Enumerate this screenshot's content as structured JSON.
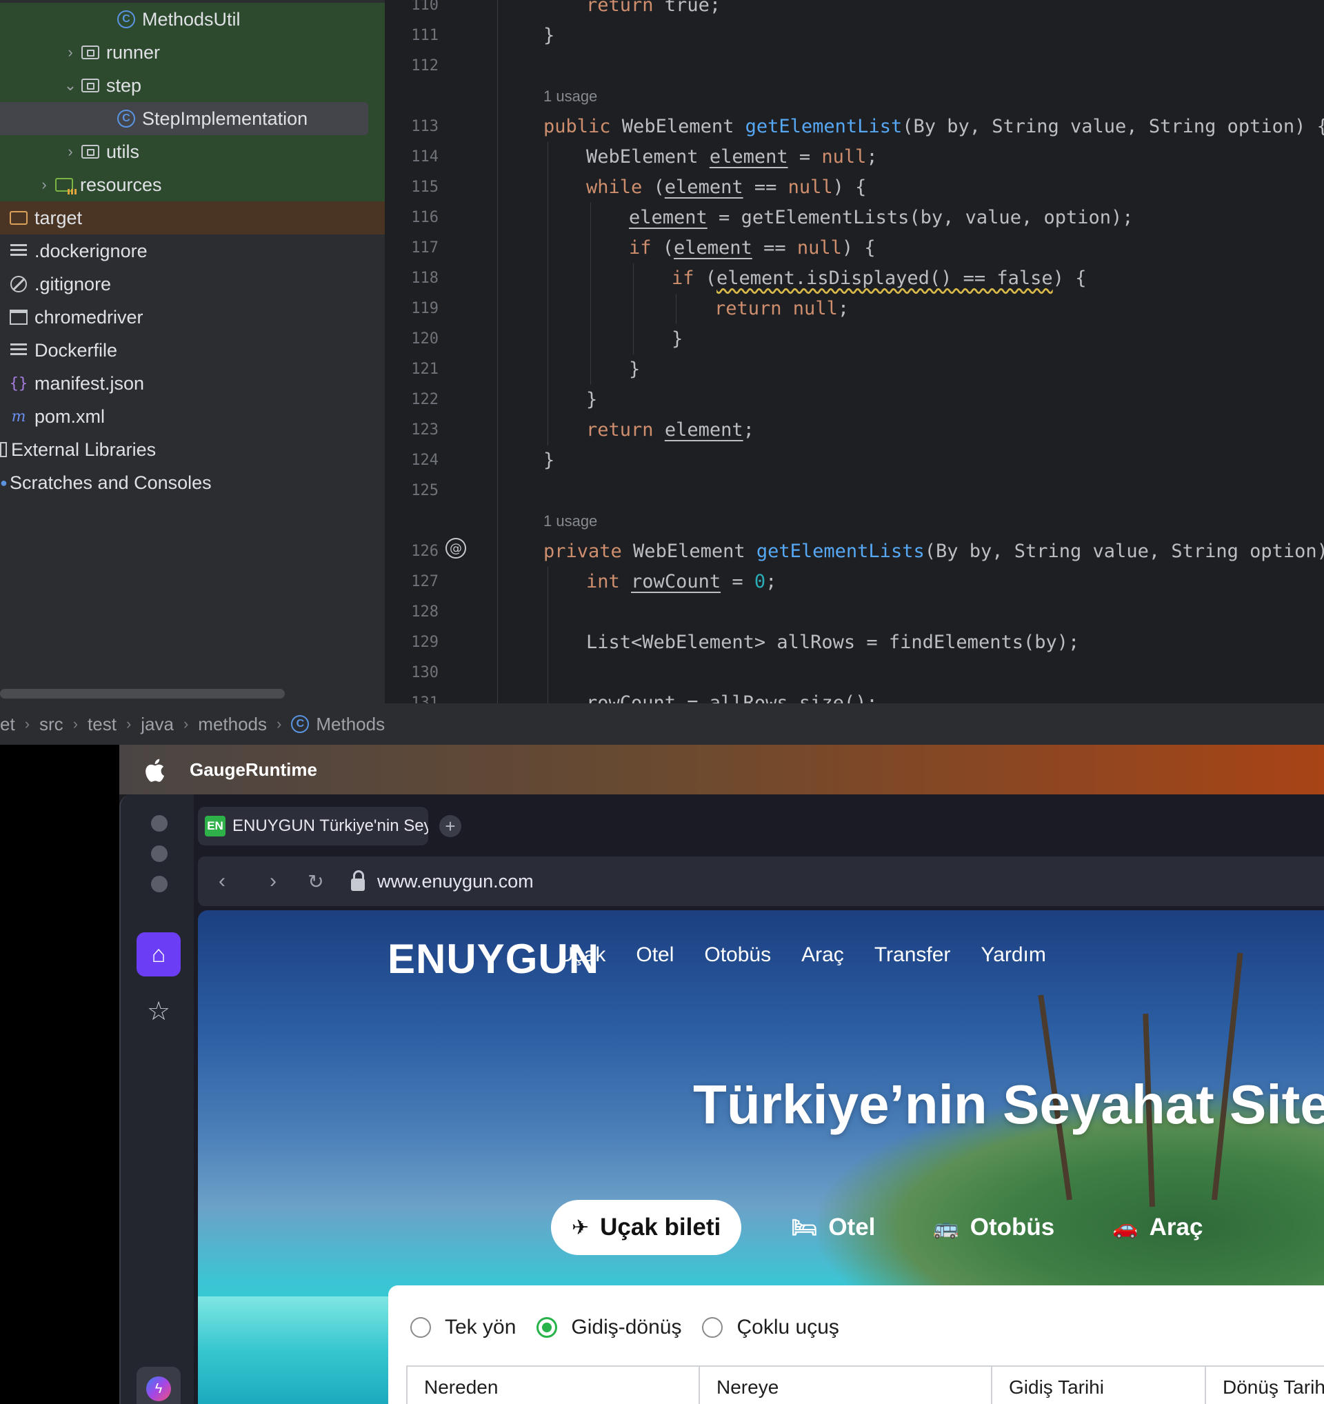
{
  "ide": {
    "tree": [
      {
        "label": "MethodsUtil",
        "icon": "class-icon",
        "indent": 3
      },
      {
        "label": "runner",
        "icon": "folder-icon",
        "indent": 2,
        "arrow": "›"
      },
      {
        "label": "step",
        "icon": "folder-icon",
        "indent": 2,
        "arrow": "⌄"
      },
      {
        "label": "StepImplementation",
        "icon": "class-icon",
        "indent": 3
      },
      {
        "label": "utils",
        "icon": "folder-icon",
        "indent": 2,
        "arrow": "›"
      },
      {
        "label": "resources",
        "icon": "resources-folder-icon",
        "indent": 1,
        "arrow": "›"
      },
      {
        "label": "target",
        "icon": "excluded-folder-icon",
        "indent": 0
      },
      {
        "label": ".dockerignore",
        "icon": "text-file-icon",
        "indent": 0
      },
      {
        "label": ".gitignore",
        "icon": "ignore-file-icon",
        "indent": 0
      },
      {
        "label": "chromedriver",
        "icon": "executable-icon",
        "indent": 0
      },
      {
        "label": "Dockerfile",
        "icon": "text-file-icon",
        "indent": 0
      },
      {
        "label": "manifest.json",
        "icon": "json-icon",
        "indent": 0
      },
      {
        "label": "pom.xml",
        "icon": "maven-icon",
        "indent": 0
      },
      {
        "label": "External Libraries",
        "icon": "library-icon",
        "indent": -1
      },
      {
        "label": "Scratches and Consoles",
        "icon": "scratches-icon",
        "indent": -1
      }
    ],
    "line_numbers": [
      "110",
      "111",
      "112",
      "113",
      "114",
      "115",
      "116",
      "117",
      "118",
      "119",
      "120",
      "121",
      "122",
      "123",
      "124",
      "125",
      "126",
      "127",
      "128",
      "129",
      "130",
      "131"
    ],
    "usage_label": "1 usage",
    "code": {
      "l110": [
        "return",
        " true;"
      ],
      "l111": "}",
      "l113": [
        "public",
        " WebElement ",
        "getElementList",
        "(By by, String value, String option) {"
      ],
      "l114": [
        "WebElement ",
        "element",
        " = ",
        "null",
        ";"
      ],
      "l115": [
        "while",
        " (",
        "element",
        " == ",
        "null",
        ") {"
      ],
      "l116": [
        "element",
        " = getElementLists(by, value, option);"
      ],
      "l117": [
        "if",
        " (",
        "element",
        " == ",
        "null",
        ") {"
      ],
      "l118": [
        "if",
        " (",
        "element.isDisplayed() == false",
        ") {"
      ],
      "l119": [
        "return",
        " null",
        ";"
      ],
      "l120": "}",
      "l121": "}",
      "l122": "}",
      "l123": [
        "return",
        " ",
        "element",
        ";"
      ],
      "l124": "}",
      "l126": [
        "private",
        " WebElement ",
        "getElementLists",
        "(By by, String value, String option) {"
      ],
      "l127": [
        "int",
        " ",
        "rowCount",
        " = ",
        "0",
        ";"
      ],
      "l129": "List<WebElement> allRows = findElements(by);",
      "l131": "rowCount = allRows.size();"
    },
    "breadcrumb": [
      "et",
      "src",
      "test",
      "java",
      "methods",
      "Methods"
    ]
  },
  "menubar": {
    "app_name": "GaugeRuntime"
  },
  "browser": {
    "tab_favicon": "EN",
    "tab_title": "ENUYGUN Türkiye'nin Seyahat Sitesi",
    "url": "www.enuygun.com"
  },
  "site": {
    "logo": "ENUYGUN",
    "nav": [
      "Uçak",
      "Otel",
      "Otobüs",
      "Araç",
      "Transfer",
      "Yardım"
    ],
    "hero": "Türkiye’nin Seyahat Sitesi",
    "product_tabs": [
      "Uçak bileti",
      "Otel",
      "Otobüs",
      "Araç"
    ],
    "trip_types": [
      "Tek yön",
      "Gidiş-dönüş",
      "Çoklu uçuş"
    ],
    "selected_trip": "Gidiş-dönüş",
    "fields": [
      "Nereden",
      "Nereye",
      "Gidiş Tarihi",
      "Dönüş Tarihi"
    ]
  },
  "colors": {
    "accent_purple": "#6b3ef5",
    "radio_green": "#27b34a",
    "keyword": "#cf8e6d",
    "function": "#56a8f5"
  }
}
